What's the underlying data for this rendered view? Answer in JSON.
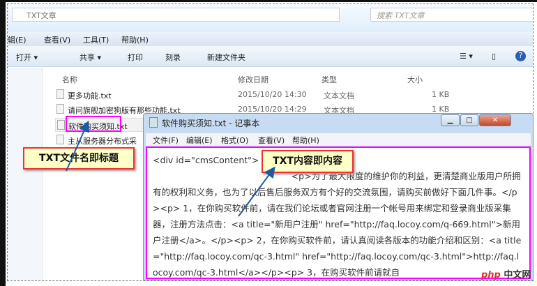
{
  "explorer": {
    "path": "TXT文章",
    "search_placeholder": "搜索 TXT文章",
    "menu": [
      "辑(E)",
      "查看(V)",
      "工具(T)",
      "帮助(H)"
    ],
    "toolbar": [
      "打开 ▾",
      "共享 ▾",
      "打印",
      "刻录",
      "新建文件夹"
    ],
    "columns": {
      "name": "名称",
      "date": "修改日期",
      "type": "类型",
      "size": "大小"
    },
    "files": [
      {
        "name": "更多功能.txt",
        "date": "2015/10/20 14:30",
        "type": "文本文档",
        "size": "1 KB"
      },
      {
        "name": "请问旗舰加密狗版有那些功能.txt",
        "date": "2015/10/20 14:29",
        "type": "文本文档",
        "size": "1 KB"
      },
      {
        "name": "软件购买须知.txt",
        "date": "",
        "type": "",
        "size": ""
      },
      {
        "name": "主从服务器分布式采",
        "date": "",
        "type": "",
        "size": ""
      }
    ]
  },
  "notepad": {
    "title": "软件购买须知.txt - 记事本",
    "menu": [
      "文件(F)",
      "编辑(E)",
      "格式(O)",
      "查看(V)",
      "帮助(H)"
    ],
    "content": "<div id=\"cmsContent\">\n                                                  <p>为了最大限度的维护你的利益，更清楚商业版用户所拥有的权利和义务，也为了以后售后服务双方有个好的交流氛围，请购买前做好下面几件事。</p><p> 1，在你购买软件前，请在我们论坛或者官网注册一个帐号用来绑定和登录商业版采集器，注册方法点击：<a title=\"新用户注册\" href=\"http://faq.locoy.com/q-669.html\">新用户注册</a>。</p><p> 2，在你购买软件前，请认真阅读各版本的功能介绍和区别：<a title=\"http://faq.locoy.com/qc-3.html\" href=\"http://faq.locoy.com/qc-3.html\">http://faq.locoy.com/qc-3.html</a></p><p> 3，在购买软件前请就自"
  },
  "callouts": {
    "filename": "TXT文件名即标题",
    "content": "TXT内容即内容"
  },
  "watermark": {
    "brand": "php",
    "text": "中文网"
  }
}
